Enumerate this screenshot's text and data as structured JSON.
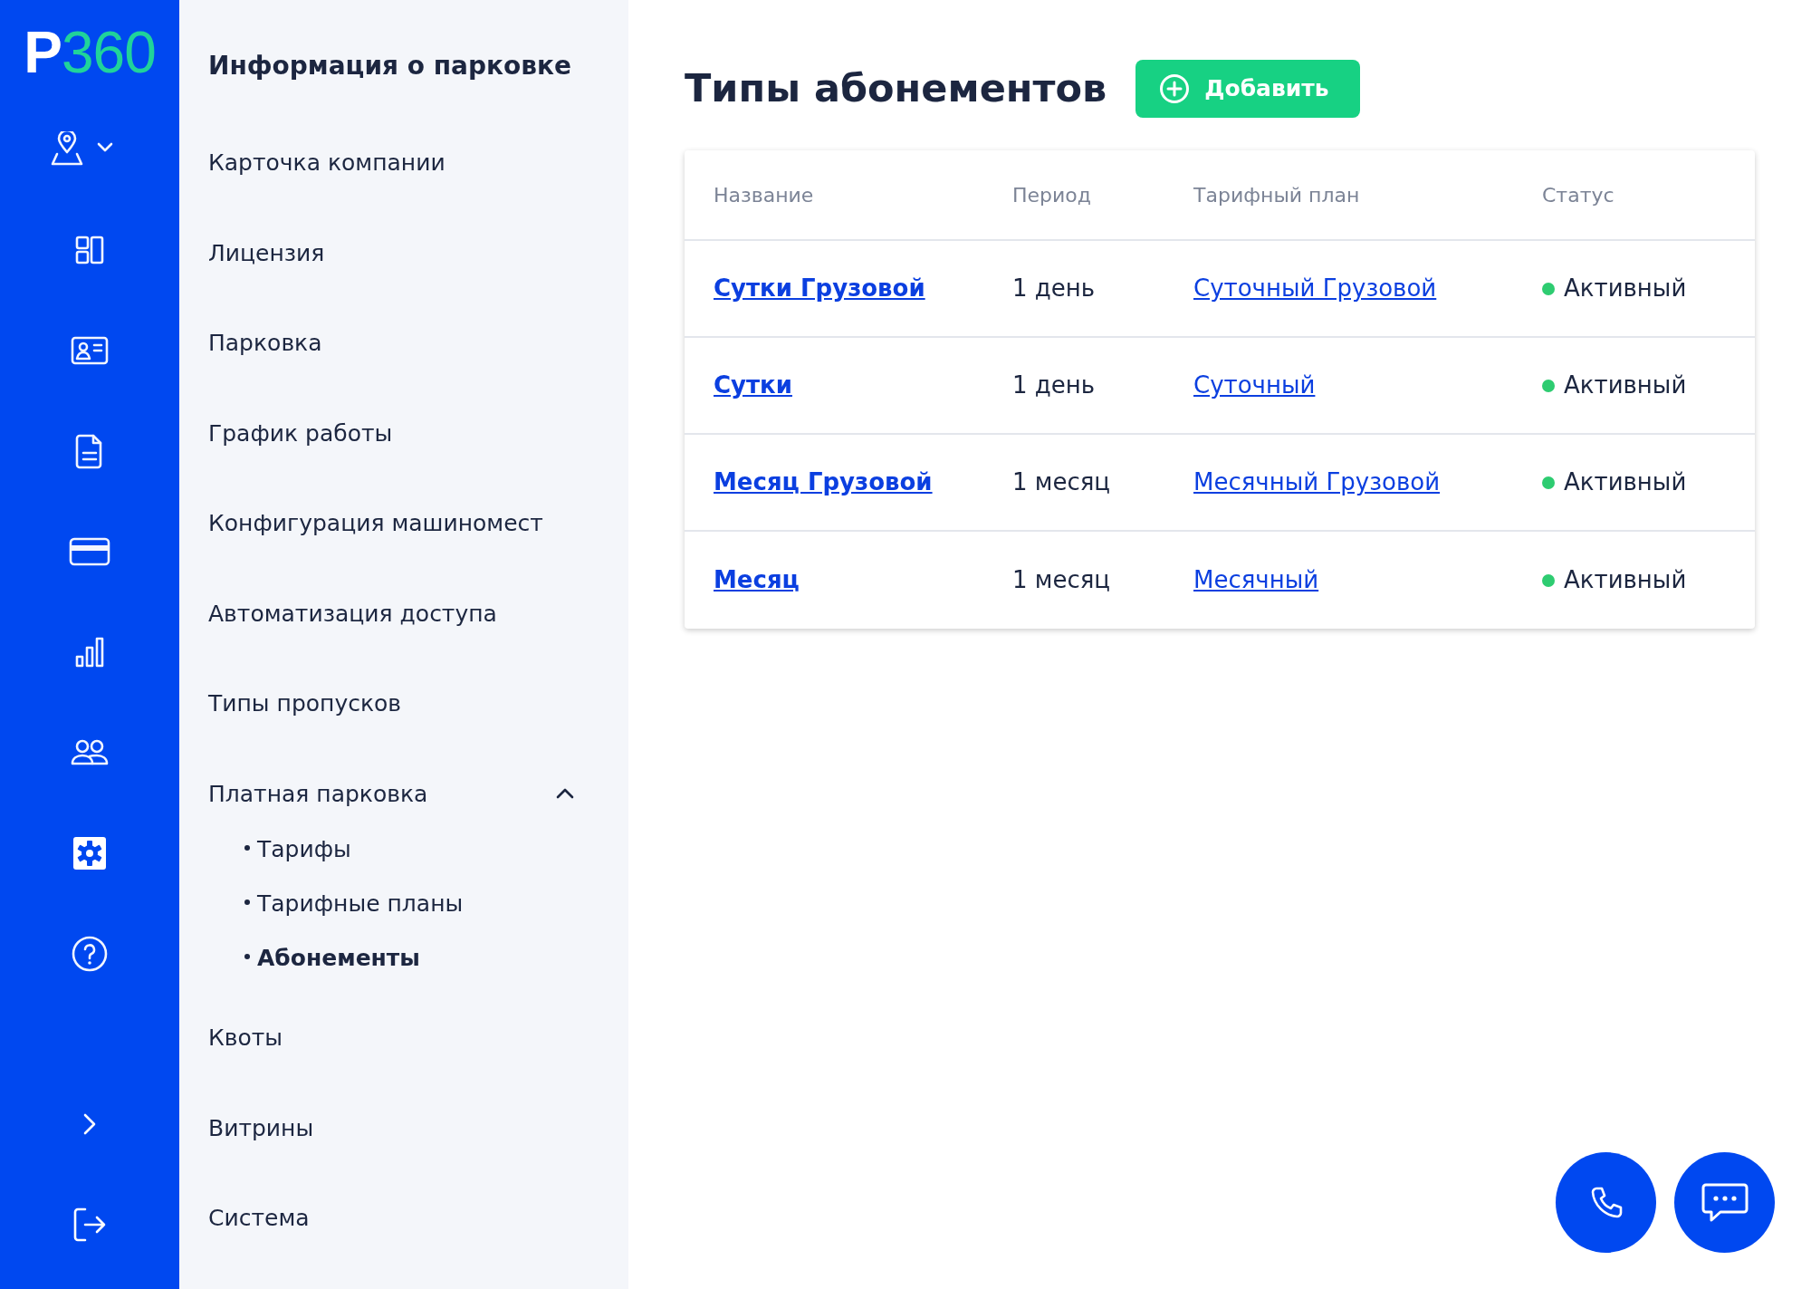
{
  "logo": {
    "letter": "P",
    "number": "360"
  },
  "rail": {
    "items": [
      {
        "selected": false
      },
      {
        "selected": false
      },
      {
        "selected": false
      },
      {
        "selected": false
      },
      {
        "selected": false
      },
      {
        "selected": false
      },
      {
        "selected": false
      },
      {
        "selected": true
      },
      {
        "selected": false
      }
    ]
  },
  "sidebar": {
    "title": "Информация о парковке",
    "items": [
      {
        "label": "Карточка компании",
        "selected": false
      },
      {
        "label": "Лицензия",
        "selected": false
      },
      {
        "label": "Парковка",
        "selected": false
      },
      {
        "label": "График работы",
        "selected": false
      },
      {
        "label": "Конфигурация машиномест",
        "selected": false
      },
      {
        "label": "Автоматизация доступа",
        "selected": false
      },
      {
        "label": "Типы пропусков",
        "selected": false
      },
      {
        "label": "Платная парковка",
        "selected": false,
        "expanded": true,
        "children": [
          {
            "label": "Тарифы",
            "selected": false
          },
          {
            "label": "Тарифные планы",
            "selected": false
          },
          {
            "label": "Абонементы",
            "selected": true
          }
        ]
      },
      {
        "label": "Квоты",
        "selected": false
      },
      {
        "label": "Витрины",
        "selected": false
      },
      {
        "label": "Система",
        "selected": false
      }
    ]
  },
  "page": {
    "title": "Типы абонементов",
    "add_button": "Добавить"
  },
  "table": {
    "columns": [
      "Название",
      "Период",
      "Тарифный план",
      "Статус"
    ],
    "rows": [
      {
        "name": "Сутки Грузовой",
        "period": "1 день",
        "plan": "Суточный Грузовой",
        "status": "Активный",
        "color": "#2ecc71"
      },
      {
        "name": "Сутки",
        "period": "1 день",
        "plan": "Суточный",
        "status": "Активный",
        "color": "#2ecc71"
      },
      {
        "name": "Месяц Грузовой",
        "period": "1 месяц",
        "plan": "Месячный Грузовой",
        "status": "Активный",
        "color": "#2ecc71"
      },
      {
        "name": "Месяц",
        "period": "1 месяц",
        "plan": "Месячный",
        "status": "Активный",
        "color": "#2ecc71"
      }
    ]
  }
}
